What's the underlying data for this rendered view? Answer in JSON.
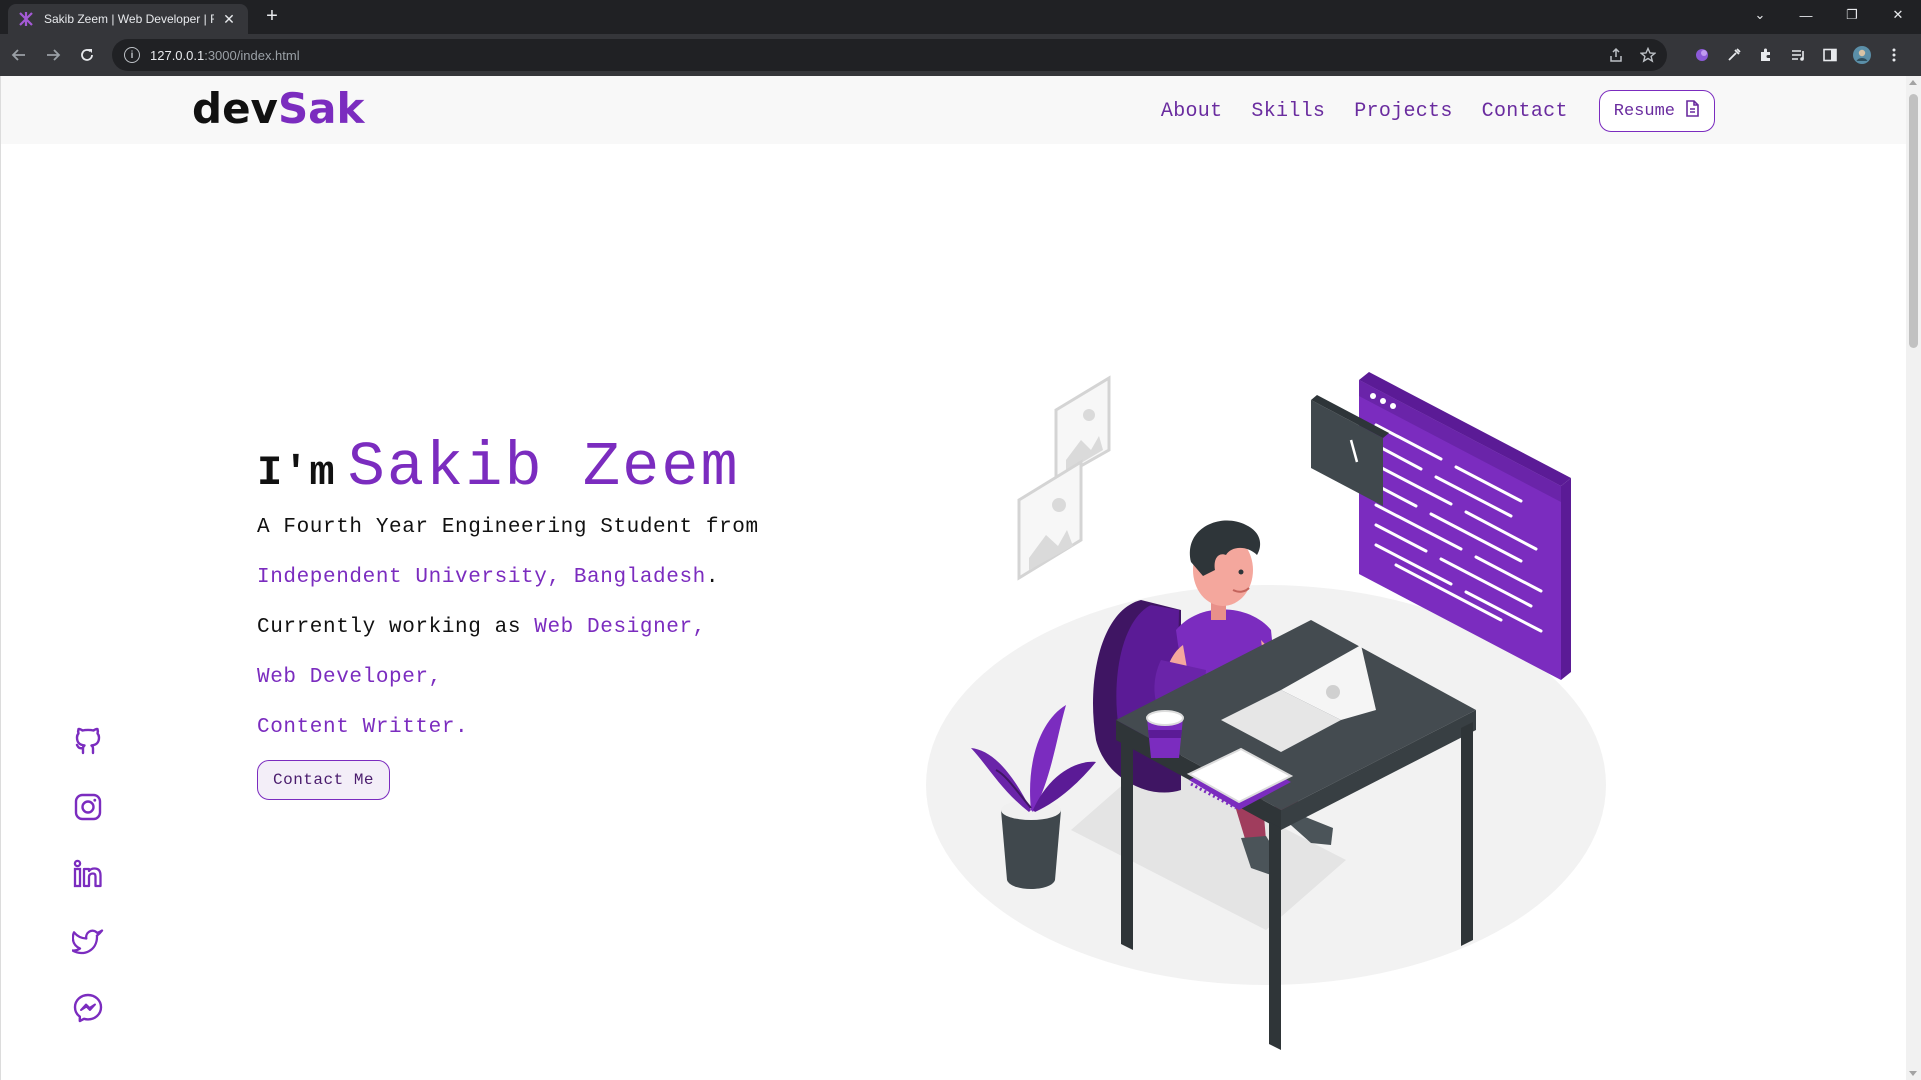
{
  "browser": {
    "tab_title": "Sakib Zeem | Web Developer | Fr",
    "url_host": "127.0.0.1",
    "url_path": ":3000/index.html"
  },
  "site": {
    "logo_part1": "dev",
    "logo_part2": "Sak",
    "nav": [
      "About",
      "Skills",
      "Projects",
      "Contact"
    ],
    "resume_label": "Resume"
  },
  "hero": {
    "greeting": "I'm",
    "name": "Sakib Zeem",
    "line1": "A Fourth Year Engineering Student from",
    "university": "Independent University, Bangladesh",
    "period": ".",
    "working_prefix": "Currently working as ",
    "role1": "Web Designer,",
    "role2": "Web Developer,",
    "role3": "Content Writter.",
    "contact_label": "Contact Me"
  },
  "socials": [
    "github-icon",
    "instagram-icon",
    "linkedin-icon",
    "twitter-icon",
    "messenger-icon"
  ],
  "colors": {
    "accent": "#7b2cbf",
    "desk": "#444b50",
    "browser_dark": "#202124"
  }
}
